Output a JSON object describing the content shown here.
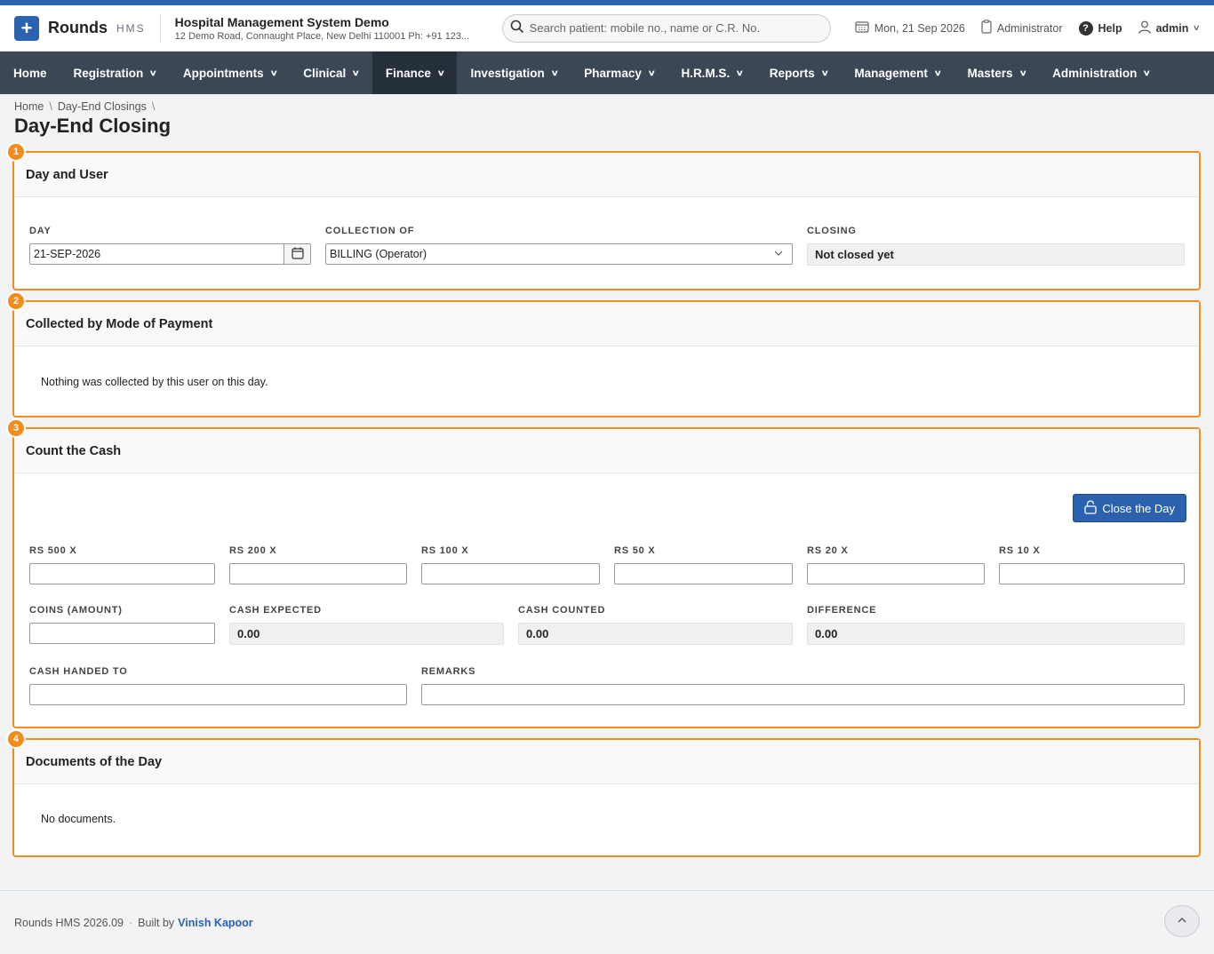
{
  "header": {
    "brand": "Rounds",
    "brand_sub": "HMS",
    "hospital_name": "Hospital Management System Demo",
    "hospital_address": "12 Demo Road, Connaught Place, New Delhi 110001 Ph: +91 123...",
    "search_placeholder": "Search patient: mobile no., name or C.R. No.",
    "date": "Mon, 21 Sep 2026",
    "role": "Administrator",
    "help": "Help",
    "user": "admin"
  },
  "nav": {
    "items": [
      {
        "label": "Home"
      },
      {
        "label": "Registration"
      },
      {
        "label": "Appointments"
      },
      {
        "label": "Clinical"
      },
      {
        "label": "Finance"
      },
      {
        "label": "Investigation"
      },
      {
        "label": "Pharmacy"
      },
      {
        "label": "H.R.M.S."
      },
      {
        "label": "Reports"
      },
      {
        "label": "Management"
      },
      {
        "label": "Masters"
      },
      {
        "label": "Administration"
      }
    ],
    "active": "Finance"
  },
  "breadcrumb": [
    "Home",
    "Day-End Closings"
  ],
  "page_title": "Day-End Closing",
  "sections": {
    "day_user": {
      "badge": "1",
      "title": "Day and User",
      "day_label": "DAY",
      "day_value": "21-SEP-2026",
      "collection_label": "COLLECTION OF",
      "collection_value": "BILLING (Operator)",
      "closing_label": "CLOSING",
      "closing_value": "Not closed yet"
    },
    "payment": {
      "badge": "2",
      "title": "Collected by Mode of Payment",
      "message": "Nothing was collected by this user on this day."
    },
    "cash": {
      "badge": "3",
      "title": "Count the Cash",
      "close_button": "Close the Day",
      "denominations": [
        "RS 500 X",
        "RS 200 X",
        "RS 100 X",
        "RS 50 X",
        "RS 20 X",
        "RS 10 X"
      ],
      "coins_label": "COINS (AMOUNT)",
      "expected_label": "CASH EXPECTED",
      "expected_value": "0.00",
      "counted_label": "CASH COUNTED",
      "counted_value": "0.00",
      "difference_label": "DIFFERENCE",
      "difference_value": "0.00",
      "handed_label": "CASH HANDED TO",
      "remarks_label": "REMARKS"
    },
    "documents": {
      "badge": "4",
      "title": "Documents of the Day",
      "message": "No documents."
    }
  },
  "footer": {
    "version": "Rounds HMS 2026.09",
    "separator": "·",
    "built_by": "Built by",
    "author": "Vinish Kapoor"
  },
  "colors": {
    "accent": "#2a62b0",
    "highlight": "#f28c1f",
    "nav_bg": "#3b4754"
  }
}
